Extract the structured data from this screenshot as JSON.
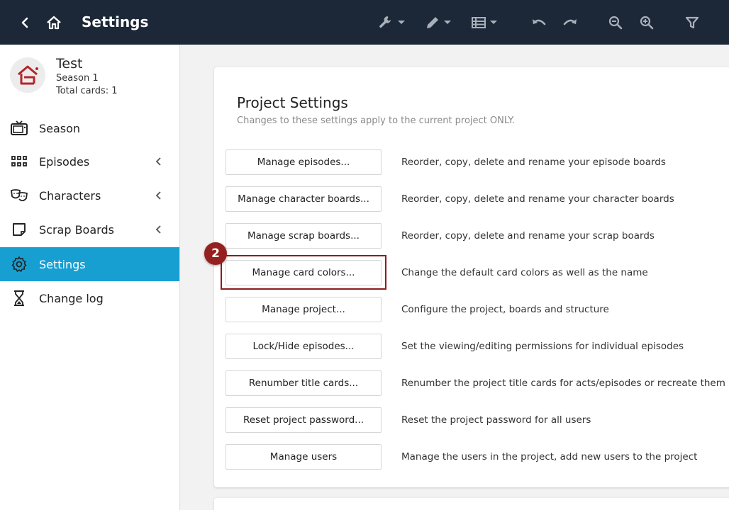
{
  "topbar": {
    "title": "Settings",
    "icons": [
      "back-arrow-icon",
      "home-icon",
      "wrench-icon",
      "pencil-icon",
      "list-icon",
      "undo-icon",
      "redo-icon",
      "zoom-out-icon",
      "zoom-in-icon",
      "filter-icon"
    ]
  },
  "project": {
    "name": "Test",
    "season": "Season 1",
    "total_cards": "Total cards: 1"
  },
  "sidebar": {
    "items": [
      {
        "label": "Season",
        "icon": "tv-icon"
      },
      {
        "label": "Episodes",
        "icon": "grid-icon",
        "expandable": true
      },
      {
        "label": "Characters",
        "icon": "theater-masks-icon",
        "expandable": true
      },
      {
        "label": "Scrap Boards",
        "icon": "sticky-note-icon",
        "expandable": true
      },
      {
        "label": "Settings",
        "icon": "gear-icon",
        "active": true
      },
      {
        "label": "Change log",
        "icon": "hourglass-icon"
      }
    ]
  },
  "main": {
    "title": "Project Settings",
    "subtitle": "Changes to these settings apply to the current project ONLY.",
    "rows": [
      {
        "button": "Manage episodes...",
        "desc": "Reorder, copy, delete and rename your episode boards"
      },
      {
        "button": "Manage character boards...",
        "desc": "Reorder, copy, delete and rename your character boards"
      },
      {
        "button": "Manage scrap boards...",
        "desc": "Reorder, copy, delete and rename your scrap boards"
      },
      {
        "button": "Manage card colors...",
        "desc": "Change the default card colors as well as the name"
      },
      {
        "button": "Manage project...",
        "desc": "Configure the project, boards and structure"
      },
      {
        "button": "Lock/Hide episodes...",
        "desc": "Set the viewing/editing permissions for individual episodes"
      },
      {
        "button": "Renumber title cards...",
        "desc": "Renumber the project title cards for acts/episodes or recreate them"
      },
      {
        "button": "Reset project password...",
        "desc": "Reset the project password for all users"
      },
      {
        "button": "Manage users",
        "desc": "Manage the users in the project, add new users to the project"
      }
    ]
  },
  "annotation": {
    "step": "2"
  },
  "colors": {
    "topbar": "#1c2838",
    "active": "#189fd2",
    "annotation": "#962020"
  }
}
